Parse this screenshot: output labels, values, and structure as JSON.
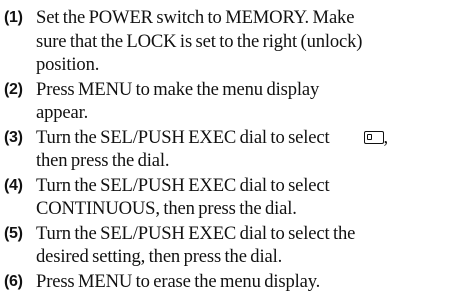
{
  "steps": [
    {
      "number": "(1)",
      "text": "Set the POWER switch to MEMORY. Make\nsure that the LOCK is set to the right (unlock)\nposition."
    },
    {
      "number": "(2)",
      "text": "Press MENU to make the menu display\nappear."
    },
    {
      "number": "(3)",
      "text_before": "Turn the SEL/PUSH EXEC dial to select",
      "icon": "memory-card-icon",
      "text_after": ",\nthen press the dial."
    },
    {
      "number": "(4)",
      "text": "Turn the SEL/PUSH EXEC dial to select\nCONTINUOUS, then press the dial."
    },
    {
      "number": "(5)",
      "text": "Turn the SEL/PUSH EXEC dial to select the\ndesired setting, then press the dial."
    },
    {
      "number": "(6)",
      "text": "Press MENU to erase the menu display."
    }
  ]
}
